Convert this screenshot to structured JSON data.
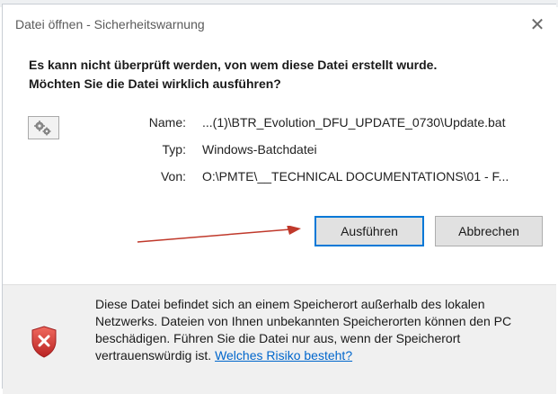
{
  "window": {
    "title": "Datei öffnen - Sicherheitswarnung",
    "close_glyph": "✕"
  },
  "prompt": {
    "line1": "Es kann nicht überprüft werden, von wem diese Datei erstellt wurde.",
    "line2": "Möchten Sie die Datei wirklich ausführen?"
  },
  "file": {
    "icon": "settings-file-icon",
    "name_label": "Name:",
    "name_value": "...(1)\\BTR_Evolution_DFU_UPDATE_0730\\Update.bat",
    "type_label": "Typ:",
    "type_value": "Windows-Batchdatei",
    "from_label": "Von:",
    "from_value": "O:\\PMTE\\__TECHNICAL DOCUMENTATIONS\\01 - F..."
  },
  "buttons": {
    "run_label": "Ausführen",
    "cancel_label": "Abbrechen"
  },
  "annotation": {
    "arrow_color": "#c0392b"
  },
  "warning": {
    "icon": "shield-warning-icon",
    "text": "Diese Datei befindet sich an einem Speicherort außerhalb des lokalen Netzwerks. Dateien von Ihnen unbekannten Speicherorten können den PC beschädigen. Führen Sie die Datei nur aus, wenn der Speicherort vertrauenswürdig ist.",
    "link_label": "Welches Risiko besteht?",
    "link_color": "#0066cc"
  },
  "colors": {
    "primary_button_border": "#0078d7",
    "footer_background": "#f0f0f0",
    "shield_red": "#d63a3a"
  }
}
